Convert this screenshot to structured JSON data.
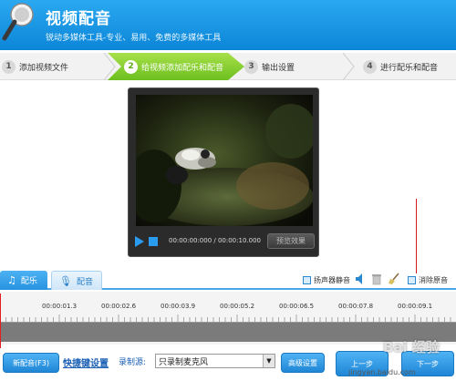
{
  "header": {
    "title": "视频配音",
    "subtitle": "锐动多媒体工具-专业、易用、免费的多媒体工具"
  },
  "steps": [
    {
      "num": "1",
      "label": "添加视频文件"
    },
    {
      "num": "2",
      "label": "给视频添加配乐和配音"
    },
    {
      "num": "3",
      "label": "输出设置"
    },
    {
      "num": "4",
      "label": "进行配乐和配音"
    }
  ],
  "player": {
    "time": "00:00:00:000 / 00:00:10.000",
    "preview_label": "预览效果"
  },
  "tabs": {
    "music": "配乐",
    "voice": "配音"
  },
  "toolbar": {
    "mute_speaker": "扬声器静音",
    "remove_original": "消除原音"
  },
  "timeline": {
    "labels": [
      "00:00:01.3",
      "00:00:02.6",
      "00:00:03.9",
      "00:00:05.2",
      "00:00:06.5",
      "00:00:07.8",
      "00:00:09.1"
    ]
  },
  "bottom": {
    "new_voice": "新配音(F3)",
    "shortcut_settings": "快捷键设置",
    "record_source_label": "录制源:",
    "record_source_value": "只录制麦克风",
    "advanced_settings": "高级设置",
    "next_label": "上一步",
    "prev_label": "下一步"
  },
  "watermark": {
    "brand": "Bai 经验",
    "url": "jingyan.baidu.com"
  },
  "colors": {
    "header_blue": "#1a96e4",
    "step_active_green": "#7cc52a",
    "accent_blue": "#2a9cf0",
    "annotation_red": "#d21a1a"
  }
}
